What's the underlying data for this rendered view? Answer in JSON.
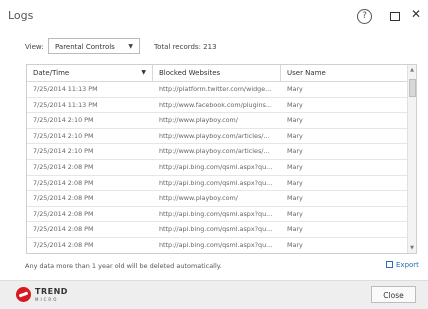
{
  "window": {
    "title": "Logs",
    "help_glyph": "?",
    "close_glyph": "✕"
  },
  "filters": {
    "view_label": "View:",
    "view_value": "Parental Controls",
    "total_records": "Total records: 213"
  },
  "table": {
    "headers": [
      "Date/Time",
      "Blocked Websites",
      "User Name"
    ],
    "sort_indicator": "▼",
    "rows": [
      [
        "7/25/2014 11:13 PM",
        "http://platform.twitter.com/widge...",
        "Mary"
      ],
      [
        "7/25/2014 11:13 PM",
        "http://www.facebook.com/plugins...",
        "Mary"
      ],
      [
        "7/25/2014 2:10 PM",
        "http://www.playboy.com/",
        "Mary"
      ],
      [
        "7/25/2014 2:10 PM",
        "http://www.playboy.com/articles/...",
        "Mary"
      ],
      [
        "7/25/2014 2:10 PM",
        "http://www.playboy.com/articles/...",
        "Mary"
      ],
      [
        "7/25/2014 2:08 PM",
        "http://api.bing.com/qsml.aspx?qu...",
        "Mary"
      ],
      [
        "7/25/2014 2:08 PM",
        "http://api.bing.com/qsml.aspx?qu...",
        "Mary"
      ],
      [
        "7/25/2014 2:08 PM",
        "http://www.playboy.com/",
        "Mary"
      ],
      [
        "7/25/2014 2:08 PM",
        "http://api.bing.com/qsml.aspx?qu...",
        "Mary"
      ],
      [
        "7/25/2014 2:08 PM",
        "http://api.bing.com/qsml.aspx?qu...",
        "Mary"
      ],
      [
        "7/25/2014 2:08 PM",
        "http://api.bing.com/qsml.aspx?qu...",
        "Mary"
      ]
    ]
  },
  "footer": {
    "retention_note": "Any data more than 1 year old will be deleted automatically.",
    "export_label": "Export",
    "close_label": "Close"
  },
  "brand": {
    "name": "TREND",
    "sub": "MICRO",
    "color": "#d71920"
  },
  "colors": {
    "accent": "#2a6fb5"
  }
}
